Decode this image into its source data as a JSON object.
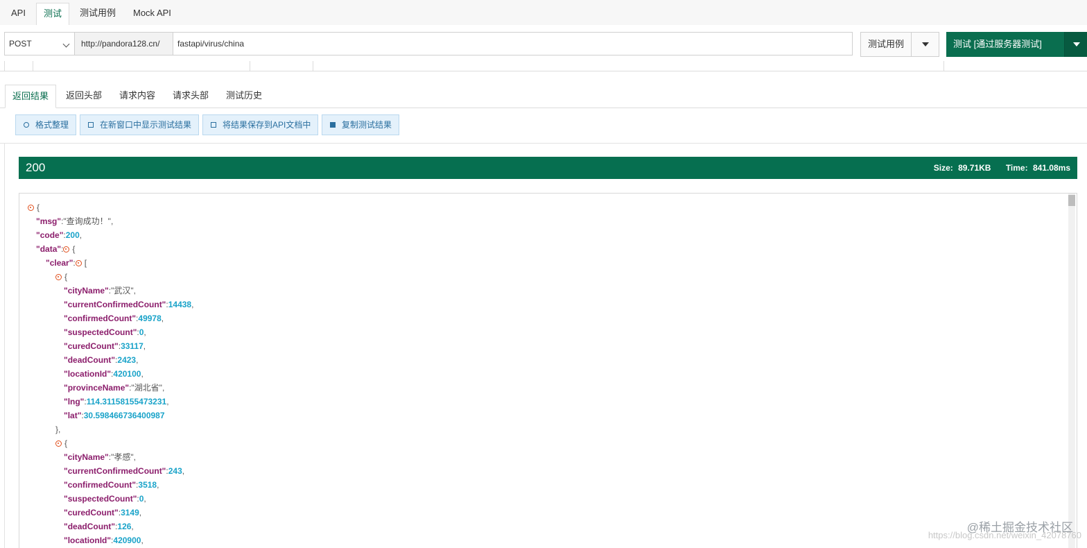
{
  "top_tabs": [
    {
      "label": "API"
    },
    {
      "label": "测试"
    },
    {
      "label": "测试用例"
    },
    {
      "label": "Mock API"
    }
  ],
  "request": {
    "method": "POST",
    "base_url": "http://pandora128.cn/",
    "path": "fastapi/virus/china",
    "case_button": "测试用例",
    "test_button": "测试 [通过服务器测试]"
  },
  "result_tabs": [
    {
      "label": "返回结果"
    },
    {
      "label": "返回头部"
    },
    {
      "label": "请求内容"
    },
    {
      "label": "请求头部"
    },
    {
      "label": "测试历史"
    }
  ],
  "actions": [
    {
      "label": "格式整理",
      "icon": "wrench-icon"
    },
    {
      "label": "在新窗口中显示测试结果",
      "icon": "external-window-icon"
    },
    {
      "label": "将结果保存到API文档中",
      "icon": "external-save-icon"
    },
    {
      "label": "复制测试结果",
      "icon": "copy-icon"
    }
  ],
  "status": {
    "code": "200",
    "size_label": "Size:",
    "size_value": "89.71KB",
    "time_label": "Time:",
    "time_value": "841.08ms"
  },
  "json": {
    "msg_key": "\"msg\"",
    "msg_val": "\"查询成功！\"",
    "code_key": "\"code\"",
    "code_val": "200",
    "data_key": "\"data\"",
    "clear_key": "\"clear\"",
    "items": [
      {
        "cityName": "\"武汉\"",
        "currentConfirmedCount": "14438",
        "confirmedCount": "49978",
        "suspectedCount": "0",
        "curedCount": "33117",
        "deadCount": "2423",
        "locationId": "420100",
        "provinceName": "\"湖北省\"",
        "lng": "114.31158155473231",
        "lat": "30.598466736400987"
      },
      {
        "cityName": "\"孝感\"",
        "currentConfirmedCount": "243",
        "confirmedCount": "3518",
        "suspectedCount": "0",
        "curedCount": "3149",
        "deadCount": "126",
        "locationId": "420900"
      }
    ]
  },
  "watermark": "@稀土掘金技术社区",
  "watermark_url": "https://blog.csdn.net/weixin_42078760"
}
